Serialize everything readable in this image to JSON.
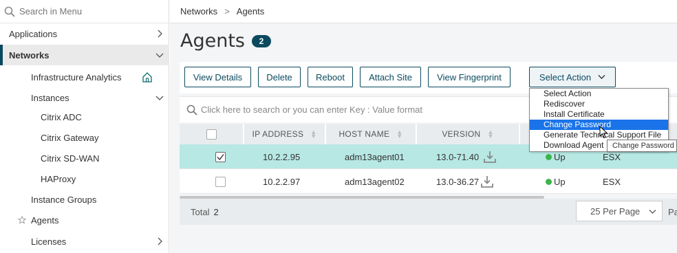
{
  "sidebar": {
    "search_placeholder": "Search in Menu",
    "items": [
      {
        "label": "Applications"
      },
      {
        "label": "Networks"
      },
      {
        "label": "Infrastructure Analytics"
      },
      {
        "label": "Instances"
      },
      {
        "label": "Citrix ADC"
      },
      {
        "label": "Citrix Gateway"
      },
      {
        "label": "Citrix SD-WAN"
      },
      {
        "label": "HAProxy"
      },
      {
        "label": "Instance Groups"
      },
      {
        "label": "Agents"
      },
      {
        "label": "Licenses"
      }
    ]
  },
  "breadcrumb": {
    "items": [
      "Networks",
      "Agents"
    ],
    "separator": ">"
  },
  "page": {
    "title": "Agents",
    "count": "2"
  },
  "toolbar": {
    "view_details": "View Details",
    "delete": "Delete",
    "reboot": "Reboot",
    "attach_site": "Attach Site",
    "view_fingerprint": "View Fingerprint",
    "select_action": "Select Action"
  },
  "search": {
    "placeholder": "Click here to search or you can enter Key : Value format"
  },
  "table": {
    "headers": [
      "IP ADDRESS",
      "HOST NAME",
      "VERSION"
    ],
    "rows": [
      {
        "ip": "10.2.2.95",
        "host": "adm13agent01",
        "version": "13.0-71.40",
        "status": "Up",
        "platform": "ESX",
        "selected": true
      },
      {
        "ip": "10.2.2.97",
        "host": "adm13agent02",
        "version": "13.0-36.27",
        "status": "Up",
        "platform": "ESX",
        "selected": false
      }
    ]
  },
  "footer": {
    "total_label": "Total",
    "total_value": "2",
    "per_page": "25 Per Page",
    "pa": "Pa"
  },
  "dropdown": {
    "options": [
      "Select Action",
      "Rediscover",
      "Install Certificate",
      "Change Password",
      "Generate Technical Support File",
      "Download Agent"
    ],
    "highlighted": "Change Password"
  },
  "tooltip": {
    "text": "Change Password"
  },
  "colors": {
    "brand": "#0b4a5e",
    "selected_row": "#b7e8e4",
    "status_up": "#3bb54a",
    "dropdown_highlight": "#1a73e8"
  }
}
